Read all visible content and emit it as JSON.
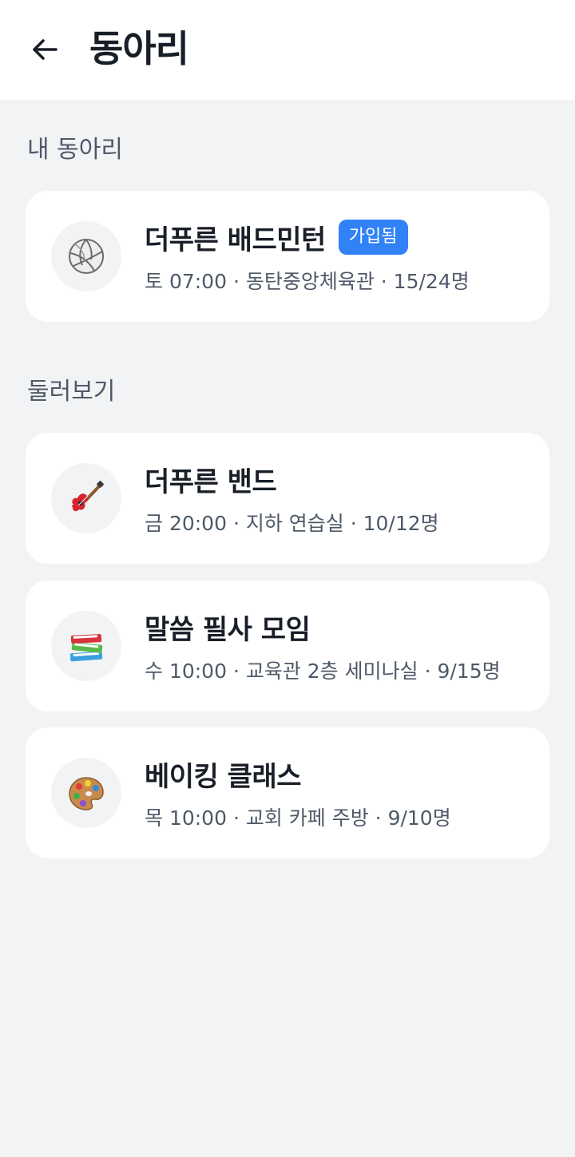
{
  "header": {
    "title": "동아리"
  },
  "sections": {
    "my_clubs_label": "내 동아리",
    "browse_label": "둘러보기"
  },
  "my_clubs": [
    {
      "name": "더푸른 배드민턴",
      "badge": "가입됨",
      "meta": "토 07:00 · 동탄중앙체육관 · 15/24명",
      "icon": "volleyball-icon"
    }
  ],
  "browse": [
    {
      "name": "더푸른 밴드",
      "meta": "금 20:00 · 지하 연습실 · 10/12명",
      "icon": "guitar-icon"
    },
    {
      "name": "말씀 필사 모임",
      "meta": "수 10:00 · 교육관 2층 세미나실 · 9/15명",
      "icon": "books-icon"
    },
    {
      "name": "베이킹 클래스",
      "meta": "목 10:00 · 교회 카페 주방 · 9/10명",
      "icon": "palette-icon"
    }
  ],
  "colors": {
    "accent": "#3182f6",
    "background": "#f2f3f5",
    "card": "#ffffff",
    "text_primary": "#191f28",
    "text_secondary": "#4e5968"
  }
}
